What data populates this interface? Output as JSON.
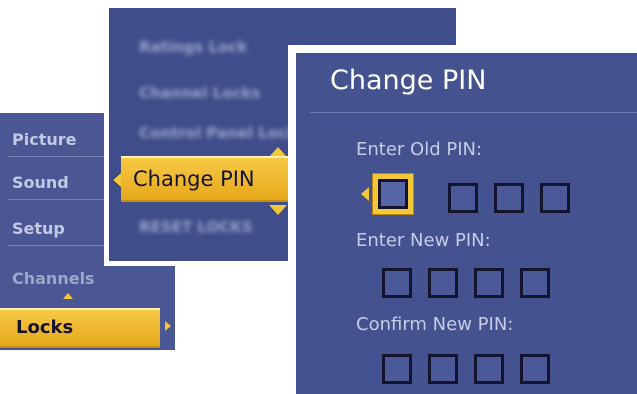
{
  "main_menu": {
    "items": [
      "Picture",
      "Sound",
      "Setup",
      "Channels"
    ],
    "selected": "Locks"
  },
  "locks_menu": {
    "items": [
      "Ratings Lock",
      "Channel Locks",
      "Control Panel Lock"
    ],
    "selected": "Change PIN",
    "last_item": "RESET LOCKS"
  },
  "change_pin": {
    "title": "Change PIN",
    "old_label": "Enter Old PIN:",
    "new_label": "Enter New PIN:",
    "confirm_label": "Confirm New PIN:"
  },
  "colors": {
    "panel": "#4b5998",
    "highlight": "#f3c73a",
    "text_light": "#c6cbe3"
  }
}
